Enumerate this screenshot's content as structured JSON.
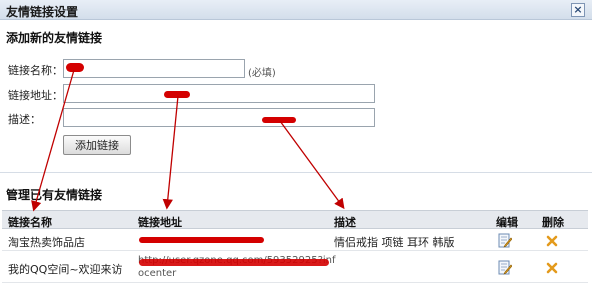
{
  "window": {
    "title": "友情链接设置",
    "close_symbol": "×"
  },
  "add_section": {
    "title": "添加新的友情链接",
    "name_label": "链接名称：",
    "name_value": "",
    "required_hint": "(必填)",
    "url_label": "链接地址：",
    "url_value": "",
    "desc_label": "描述：",
    "desc_value": "",
    "submit_label": "添加链接"
  },
  "manage_section": {
    "title": "管理已有友情链接",
    "columns": {
      "name": "链接名称",
      "url": "链接地址",
      "desc": "描述",
      "edit": "编辑",
      "delete": "删除"
    },
    "rows": [
      {
        "name": "淘宝热卖饰品店",
        "url": "",
        "desc": "情侣戒指 项链 耳环 韩版"
      },
      {
        "name": "我的QQ空间~欢迎来访",
        "url": "http://user.qzone.qq.com/59352925?inf",
        "url_cont": "ocenter",
        "desc": ""
      }
    ]
  },
  "annotation": {
    "color": "#d40000"
  }
}
